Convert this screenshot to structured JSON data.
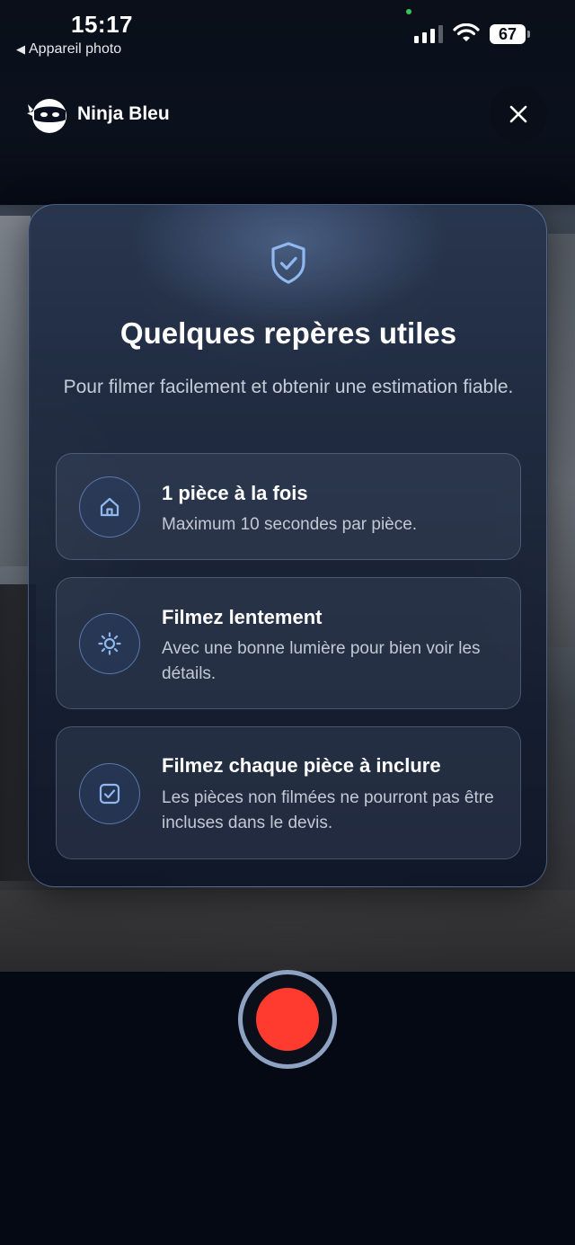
{
  "status_bar": {
    "time": "15:17",
    "back_label": "Appareil photo",
    "battery_level": "67",
    "signal_bars": 3,
    "icons": [
      "back-caret-icon",
      "cellular-signal-icon",
      "wifi-icon",
      "battery-icon"
    ]
  },
  "header": {
    "brand_name": "Ninja Bleu",
    "logo_icon": "ninja-logo-icon",
    "close_icon": "close-icon"
  },
  "modal": {
    "icon": "shield-check-icon",
    "title": "Quelques repères utiles",
    "subtitle": "Pour filmer facilement et obtenir une estimation fiable.",
    "tips": [
      {
        "icon": "house-icon",
        "title": "1 pièce à la fois",
        "text": "Maximum 10 secondes par pièce."
      },
      {
        "icon": "sun-icon",
        "title": "Filmez lentement",
        "text": "Avec une bonne lumière pour bien voir les détails."
      },
      {
        "icon": "checkbox-icon",
        "title": "Filmez chaque pièce à inclure",
        "text": "Les pièces non filmées ne pourront pas être incluses dans le devis."
      }
    ]
  },
  "controls": {
    "record_icon": "record-button-icon"
  },
  "colors": {
    "background": "#050914",
    "accent": "#8fb8f0",
    "record": "#ff3b30",
    "recording_ring": "#8ea3c2",
    "privacy_dot": "#35c759"
  }
}
